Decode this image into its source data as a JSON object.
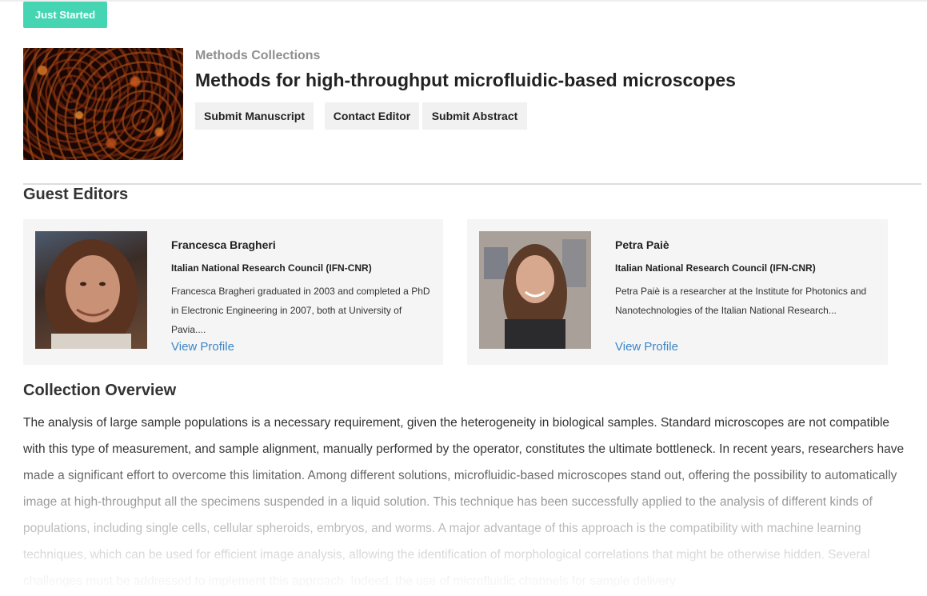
{
  "status": {
    "label": "Just Started",
    "color": "#46d5b3"
  },
  "collection": {
    "label": "Methods Collections",
    "title": "Methods for high-throughput microfluidic-based microscopes"
  },
  "actions": {
    "submit_manuscript": "Submit Manuscript",
    "contact_editor": "Contact Editor",
    "submit_abstract": "Submit Abstract"
  },
  "guest_editors": {
    "heading": "Guest Editors",
    "editors": [
      {
        "name": "Francesca Bragheri",
        "affiliation": "Italian National Research Council (IFN-CNR)",
        "bio": "Francesca Bragheri graduated in 2003 and completed a PhD in Electronic Engineering in 2007, both at University of Pavia....",
        "link": "View Profile"
      },
      {
        "name": "Petra Paiè",
        "affiliation": "Italian National Research Council (IFN-CNR)",
        "bio": "Petra Paiè is a researcher at the Institute for Photonics and Nanotechnologies of the Italian National Research...",
        "link": "View Profile"
      }
    ]
  },
  "overview": {
    "heading": "Collection Overview",
    "text": "The analysis of large sample populations is a necessary requirement, given the heterogeneity in biological samples. Standard microscopes are not compatible with this type of measurement, and sample alignment, manually performed by the operator, constitutes the ultimate bottleneck. In recent years, researchers have made a significant effort to overcome this limitation. Among different solutions, microfluidic-based microscopes stand out, offering the possibility to automatically image at high-throughput all the specimens suspended in a liquid solution. This technique has been successfully applied to the analysis of different kinds of populations, including single cells, cellular spheroids, embryos, and worms. A major advantage of this approach is the compatibility with machine learning techniques, which can be used for efficient image analysis, allowing the identification of morphological correlations that might be otherwise hidden. Several challenges must be addressed to implement this approach. Indeed, the use of microfluidic channels for sample delivery"
  },
  "colors": {
    "accent": "#46d5b3",
    "link": "#3d85c6",
    "card_bg": "#f5f5f5"
  }
}
